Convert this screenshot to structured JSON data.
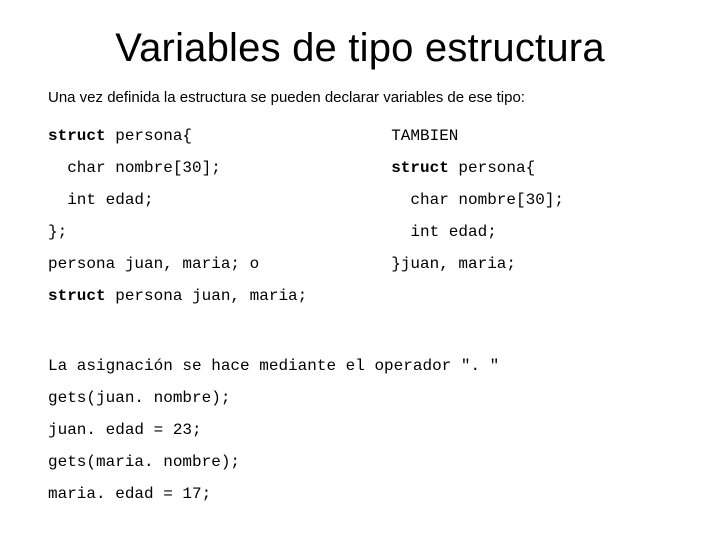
{
  "title": "Variables de tipo estructura",
  "intro": "Una vez definida la estructura se pueden declarar variables de ese tipo:",
  "left": {
    "l1a": "struct",
    "l1b": " persona{",
    "l2": "  char nombre[30];",
    "l3": "  int edad;",
    "l4": "};",
    "l5": "persona juan, maria; o",
    "l6a": "struct",
    "l6b": " persona juan, maria;"
  },
  "right": {
    "r1": "TAMBIEN",
    "r2a": "struct",
    "r2b": " persona{",
    "r3": "  char nombre[30];",
    "r4": "  int edad;",
    "r5": "}juan, maria;"
  },
  "bottom": {
    "b1": "La asignación se hace mediante el operador \". \"",
    "b2": "gets(juan. nombre);",
    "b3": "juan. edad = 23;",
    "b4": "gets(maria. nombre);",
    "b5": "maria. edad = 17;"
  }
}
